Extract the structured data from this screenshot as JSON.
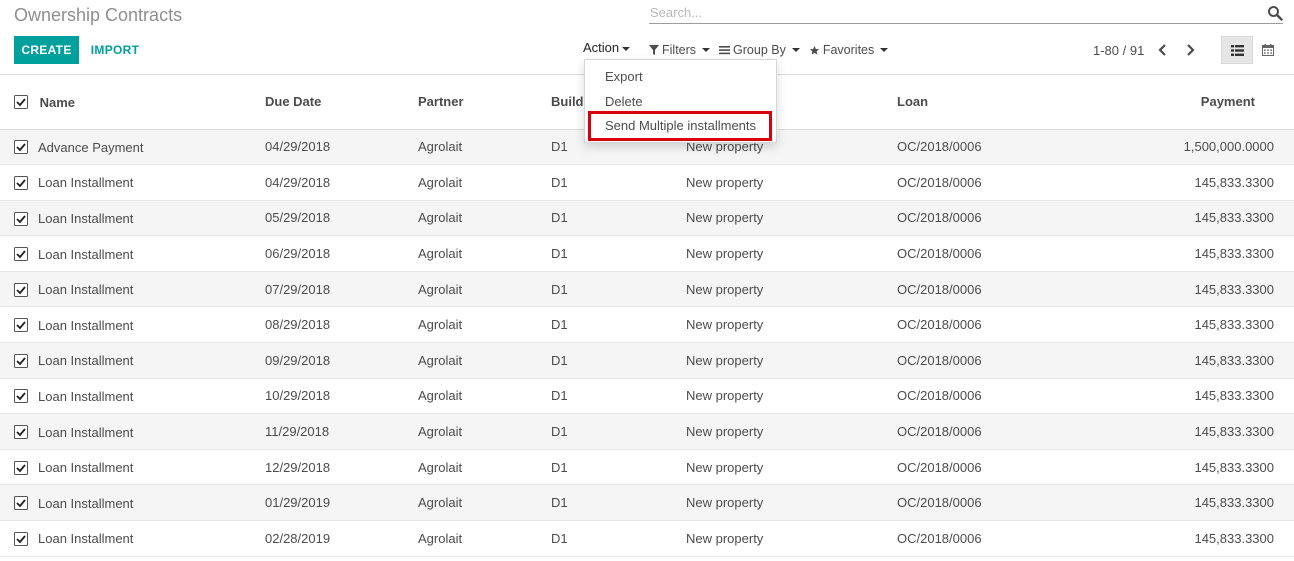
{
  "page": {
    "title": "Ownership Contracts"
  },
  "search": {
    "placeholder": "Search..."
  },
  "toolbar": {
    "create_label": "CREATE",
    "import_label": "IMPORT"
  },
  "action_menu": {
    "label": "Action",
    "items": [
      "Export",
      "Delete",
      "Send Multiple installments"
    ],
    "highlighted_item": "Send Multiple installments",
    "highlight_color": "#d9000d"
  },
  "filters": {
    "filters_label": "Filters",
    "group_by_label": "Group By",
    "favorites_label": "Favorites"
  },
  "pager": {
    "range": "1-80 / 91"
  },
  "views": {
    "active": "list",
    "available": [
      "list-icon",
      "calendar-icon"
    ]
  },
  "colors": {
    "accent": "#00a09d"
  },
  "table": {
    "columns": [
      "Name",
      "Due Date",
      "Partner",
      "Building",
      "",
      "Loan",
      "Payment"
    ],
    "columns_visible": [
      "Name",
      "Due Date",
      "Partner",
      "Buildi",
      "",
      "Loan",
      "Payment"
    ],
    "rows": [
      {
        "name": "Advance Payment",
        "due_date": "04/29/2018",
        "partner": "Agrolait",
        "building": "D1",
        "property": "New property",
        "loan": "OC/2018/0006",
        "payment": "1,500,000.0000",
        "checked": true
      },
      {
        "name": "Loan Installment",
        "due_date": "04/29/2018",
        "partner": "Agrolait",
        "building": "D1",
        "property": "New property",
        "loan": "OC/2018/0006",
        "payment": "145,833.3300",
        "checked": true
      },
      {
        "name": "Loan Installment",
        "due_date": "05/29/2018",
        "partner": "Agrolait",
        "building": "D1",
        "property": "New property",
        "loan": "OC/2018/0006",
        "payment": "145,833.3300",
        "checked": true
      },
      {
        "name": "Loan Installment",
        "due_date": "06/29/2018",
        "partner": "Agrolait",
        "building": "D1",
        "property": "New property",
        "loan": "OC/2018/0006",
        "payment": "145,833.3300",
        "checked": true
      },
      {
        "name": "Loan Installment",
        "due_date": "07/29/2018",
        "partner": "Agrolait",
        "building": "D1",
        "property": "New property",
        "loan": "OC/2018/0006",
        "payment": "145,833.3300",
        "checked": true
      },
      {
        "name": "Loan Installment",
        "due_date": "08/29/2018",
        "partner": "Agrolait",
        "building": "D1",
        "property": "New property",
        "loan": "OC/2018/0006",
        "payment": "145,833.3300",
        "checked": true
      },
      {
        "name": "Loan Installment",
        "due_date": "09/29/2018",
        "partner": "Agrolait",
        "building": "D1",
        "property": "New property",
        "loan": "OC/2018/0006",
        "payment": "145,833.3300",
        "checked": true
      },
      {
        "name": "Loan Installment",
        "due_date": "10/29/2018",
        "partner": "Agrolait",
        "building": "D1",
        "property": "New property",
        "loan": "OC/2018/0006",
        "payment": "145,833.3300",
        "checked": true
      },
      {
        "name": "Loan Installment",
        "due_date": "11/29/2018",
        "partner": "Agrolait",
        "building": "D1",
        "property": "New property",
        "loan": "OC/2018/0006",
        "payment": "145,833.3300",
        "checked": true
      },
      {
        "name": "Loan Installment",
        "due_date": "12/29/2018",
        "partner": "Agrolait",
        "building": "D1",
        "property": "New property",
        "loan": "OC/2018/0006",
        "payment": "145,833.3300",
        "checked": true
      },
      {
        "name": "Loan Installment",
        "due_date": "01/29/2019",
        "partner": "Agrolait",
        "building": "D1",
        "property": "New property",
        "loan": "OC/2018/0006",
        "payment": "145,833.3300",
        "checked": true
      },
      {
        "name": "Loan Installment",
        "due_date": "02/28/2019",
        "partner": "Agrolait",
        "building": "D1",
        "property": "New property",
        "loan": "OC/2018/0006",
        "payment": "145,833.3300",
        "checked": true
      }
    ]
  }
}
